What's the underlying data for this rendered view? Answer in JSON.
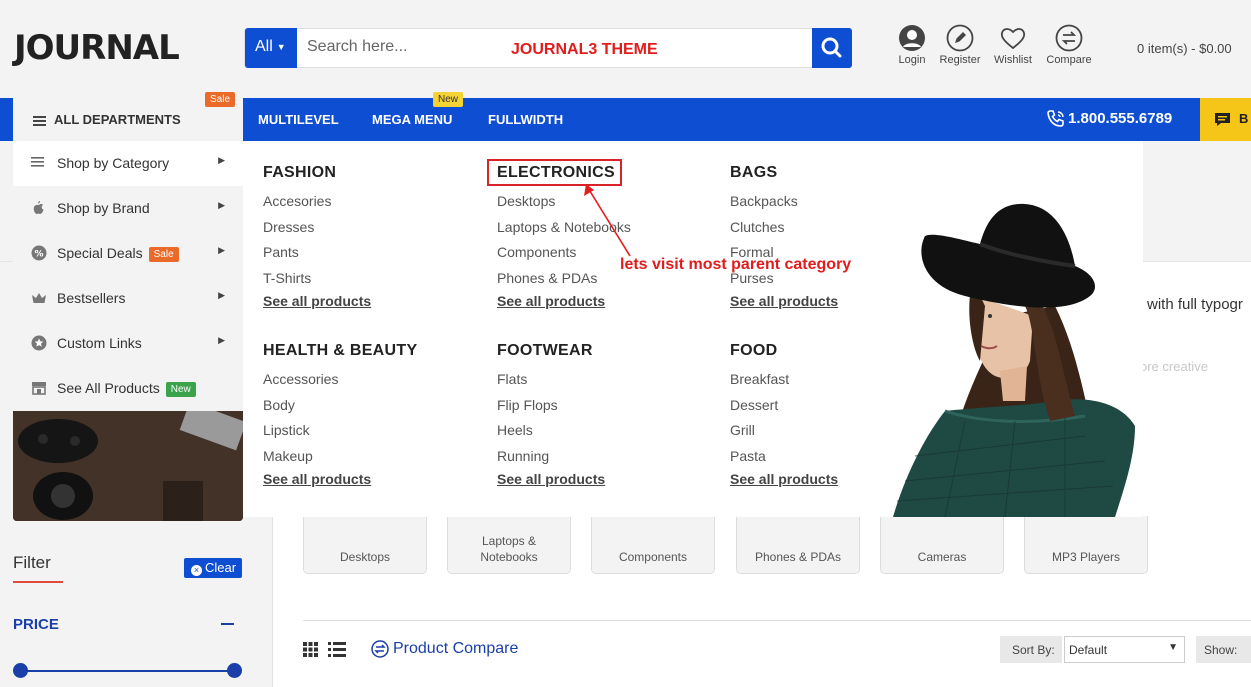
{
  "brand": {
    "logo": "JOURNAL"
  },
  "search": {
    "category": "All",
    "placeholder": "Search here...",
    "overlay_note": "JOURNAL3 THEME"
  },
  "header_links": [
    {
      "label": "Login",
      "icon": "user-icon"
    },
    {
      "label": "Register",
      "icon": "pencil-icon"
    },
    {
      "label": "Wishlist",
      "icon": "heart-icon"
    },
    {
      "label": "Compare",
      "icon": "compare-icon"
    }
  ],
  "cart": {
    "summary": "0 item(s) - $0.00"
  },
  "nav": {
    "all_departments": "ALL DEPARTMENTS",
    "all_departments_badge": "Sale",
    "items": [
      {
        "label": "MULTILEVEL"
      },
      {
        "label": "MEGA MENU",
        "badge": "New"
      },
      {
        "label": "FULLWIDTH"
      }
    ],
    "phone": "1.800.555.6789",
    "yellow_button": "B"
  },
  "left_menu": [
    {
      "label": "Shop by Category",
      "icon": "menu-lines-icon",
      "active": true
    },
    {
      "label": "Shop by Brand",
      "icon": "apple-icon"
    },
    {
      "label": "Special Deals",
      "icon": "percent-icon",
      "badge": "Sale"
    },
    {
      "label": "Bestsellers",
      "icon": "crown-icon"
    },
    {
      "label": "Custom Links",
      "icon": "star-icon"
    },
    {
      "label": "See All Products",
      "icon": "store-icon",
      "badge": "New"
    }
  ],
  "mega_menu": {
    "columns": [
      {
        "title": "FASHION",
        "links": [
          "Accesories",
          "Dresses",
          "Pants",
          "T-Shirts"
        ],
        "see_all": "See all products"
      },
      {
        "title": "ELECTRONICS",
        "links": [
          "Desktops",
          "Laptops & Notebooks",
          "Components",
          "Phones & PDAs"
        ],
        "see_all": "See all products"
      },
      {
        "title": "BAGS",
        "links": [
          "Backpacks",
          "Clutches",
          "Formal",
          "Purses"
        ],
        "see_all": "See all products"
      },
      {
        "title": "HEALTH & BEAUTY",
        "links": [
          "Accessories",
          "Body",
          "Lipstick",
          "Makeup"
        ],
        "see_all": "See all products"
      },
      {
        "title": "FOOTWEAR",
        "links": [
          "Flats",
          "Flip Flops",
          "Heels",
          "Running"
        ],
        "see_all": "See all products"
      },
      {
        "title": "FOOD",
        "links": [
          "Breakfast",
          "Dessert",
          "Grill",
          "Pasta"
        ],
        "see_all": "See all products"
      }
    ]
  },
  "annotation": {
    "text": "lets visit most parent category"
  },
  "sidebar": {
    "filter_title": "Filter",
    "clear_label": "Clear",
    "price_title": "PRICE"
  },
  "category_tiles": [
    "Desktops",
    "Laptops & Notebooks",
    "Components",
    "Phones & PDAs",
    "Cameras",
    "MP3 Players"
  ],
  "toolbar": {
    "compare_label": "Product Compare",
    "sort_label": "Sort By:",
    "sort_value": "Default",
    "show_label": "Show:"
  },
  "background_text": {
    "line1": "with full typogr",
    "line2": "ore creative"
  },
  "colors": {
    "primary": "#0e4ed3",
    "accent": "#f5c518",
    "annotation": "#e21c1c",
    "sale": "#ea6a2a",
    "new": "#3aa34c"
  }
}
